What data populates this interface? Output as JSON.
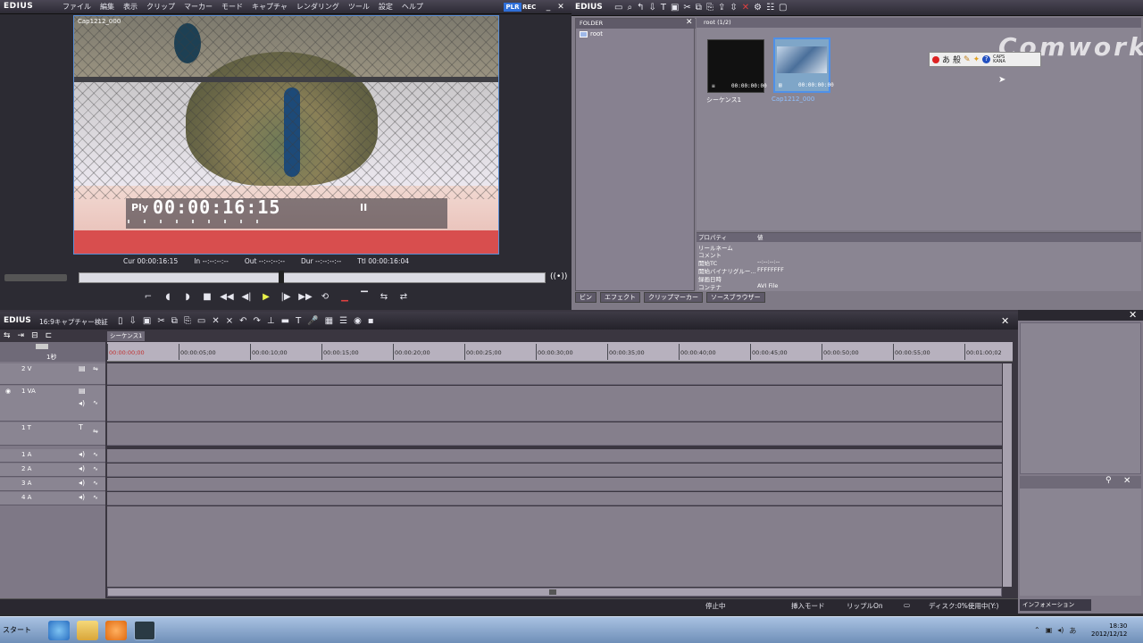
{
  "app": {
    "name": "EDIUS",
    "brand_color": "#2f6fd8"
  },
  "player": {
    "menu": [
      "ファイル",
      "編集",
      "表示",
      "クリップ",
      "マーカー",
      "モード",
      "キャプチャ",
      "レンダリング",
      "ツール",
      "設定",
      "ヘルプ"
    ],
    "plr": "PLR",
    "rec": "REC",
    "clip_caption": "Cap1212_000",
    "overlay_label": "Ply",
    "overlay_timecode": "00:00:16:15",
    "overlay_pause": "II",
    "cur": "Cur 00:00:16:15",
    "in": "In --:--:--:--",
    "out": "Out --:--:--:--",
    "dur": "Dur --:--:--:--",
    "ttl": "Ttl 00:00:16:04"
  },
  "bin": {
    "title": "EDIUS",
    "folder_header": "FOLDER",
    "folder_root": "root",
    "clip_header": "root (1/2)",
    "watermark": "Comworks",
    "clips": [
      {
        "name": "シーケンス1",
        "tc": "00:00:00:00"
      },
      {
        "name": "Cap1212_000",
        "tc": "00:00:00:00"
      }
    ],
    "ime": {
      "mode1": "あ",
      "mode2": "般",
      "caps": "CAPS",
      "kana": "KANA"
    },
    "props_header": {
      "name": "プロパティ",
      "value": "値"
    },
    "props": [
      {
        "name": "リールネーム",
        "value": ""
      },
      {
        "name": "コメント",
        "value": ""
      },
      {
        "name": "開始TC",
        "value": "--:--:--:--"
      },
      {
        "name": "開始バイナリグルー...",
        "value": "FFFFFFFF"
      },
      {
        "name": "録画日時",
        "value": ""
      },
      {
        "name": "コンテナ",
        "value": "AVI File"
      }
    ],
    "tabs": [
      "ビン",
      "エフェクト",
      "クリップマーカー",
      "ソースブラウザー"
    ]
  },
  "timeline": {
    "logo": "EDIUS",
    "subtitle": "16:9キャプチャー検証",
    "sequence_tab": "シーケンス1",
    "scale": "1秒",
    "ruler": [
      "00:00:00;00",
      "00:00:05;00",
      "00:00:10;00",
      "00:00:15;00",
      "00:00:20;00",
      "00:00:25;00",
      "00:00:30;00",
      "00:00:35;00",
      "00:00:40;00",
      "00:00:45;00",
      "00:00:50;00",
      "00:00:55;00",
      "00:01:00;02"
    ],
    "tracks": [
      {
        "name": "2 V"
      },
      {
        "name": "1 VA"
      },
      {
        "name": "1 T"
      },
      {
        "name": "1 A"
      },
      {
        "name": "2 A"
      },
      {
        "name": "3 A"
      },
      {
        "name": "4 A"
      }
    ]
  },
  "status": {
    "stopped": "停止中",
    "insert_mode": "挿入モード",
    "ripple": "リップルOn",
    "disk": "ディスク:0%使用中(Y:)"
  },
  "right_panel": {
    "info_tab": "インフォメーション"
  },
  "taskbar": {
    "start": "スタート",
    "time": "18:30",
    "date": "2012/12/12"
  }
}
